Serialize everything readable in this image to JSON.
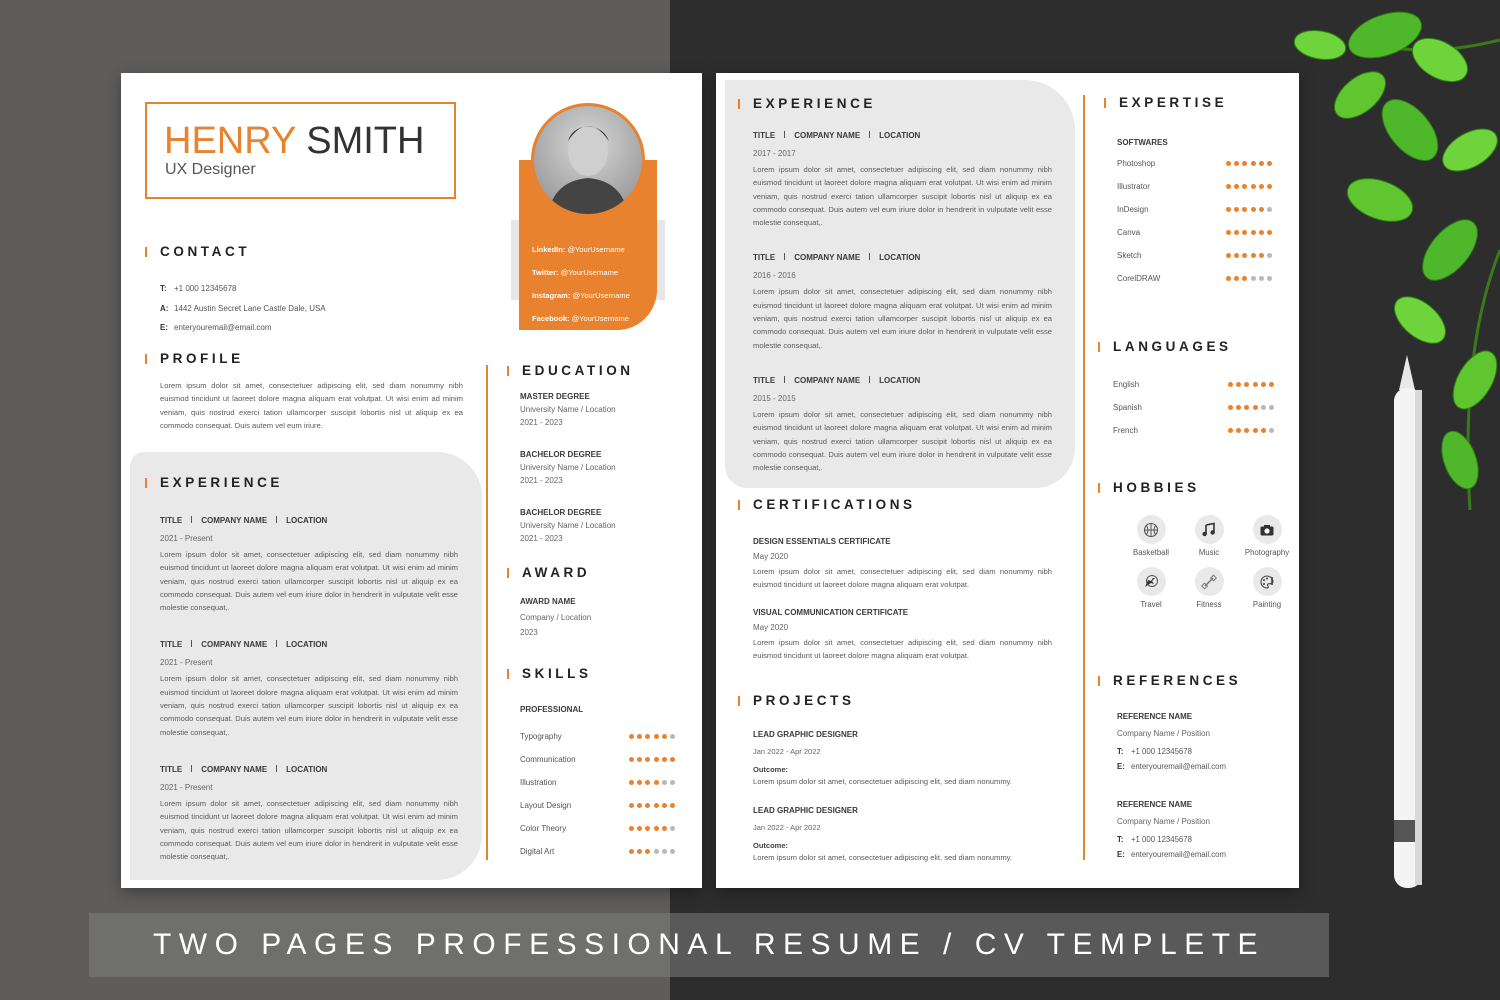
{
  "colors": {
    "accent": "#e8822e",
    "panel": "#e9e9e9",
    "text": "#222222"
  },
  "banner": {
    "text": "TWO PAGES PROFESSIONAL RESUME / CV TEMPLETE"
  },
  "page1": {
    "name": {
      "first": "HENRY",
      "last": "SMITH",
      "title": "UX Designer"
    },
    "social": [
      {
        "label": "LinkedIn:",
        "value": "@YourUsername"
      },
      {
        "label": "Twitter:",
        "value": "@YourUsername"
      },
      {
        "label": "Instagram:",
        "value": "@YourUsername"
      },
      {
        "label": "Facebook:",
        "value": "@YourUsername"
      }
    ],
    "contact": {
      "heading": "CONTACT",
      "items": [
        {
          "key": "T:",
          "value": "+1 000 12345678"
        },
        {
          "key": "A:",
          "value": "1442 Austin Secret Lane Castle Dale, USA"
        },
        {
          "key": "E:",
          "value": "enteryouremail@email.com"
        }
      ]
    },
    "profile": {
      "heading": "PROFILE",
      "text": "Lorem ipsum dolor sit amet, consectetuer adipiscing elit, sed diam nonummy nibh euismod tincidunt ut laoreet dolore magna aliquam erat volutpat. Ut wisi enim ad minim veniam, quis nostrud exerci tation ullamcorper suscipit lobortis nisl ut aliquip ex ea commodo consequat. Duis autem vel eum iriure."
    },
    "experience": {
      "heading": "EXPERIENCE",
      "entries": [
        {
          "title": "TITLE",
          "company": "COMPANY NAME",
          "location": "LOCATION",
          "date": "2021 - Present",
          "text": "Lorem ipsum dolor sit amet, consectetuer adipiscing elit, sed diam nonummy nibh euismod tincidunt ut laoreet dolore magna aliquam erat volutpat. Ut wisi enim ad minim veniam, quis nostrud exerci tation ullamcorper suscipit lobortis nisl ut aliquip ex ea commodo consequat. Duis autem vel eum iriure dolor in hendrerit in vulputate velit esse molestie consequat,."
        },
        {
          "title": "TITLE",
          "company": "COMPANY NAME",
          "location": "LOCATION",
          "date": "2021 - Present",
          "text": "Lorem ipsum dolor sit amet, consectetuer adipiscing elit, sed diam nonummy nibh euismod tincidunt ut laoreet dolore magna aliquam erat volutpat. Ut wisi enim ad minim veniam, quis nostrud exerci tation ullamcorper suscipit lobortis nisl ut aliquip ex ea commodo consequat. Duis autem vel eum iriure dolor in hendrerit in vulputate velit esse molestie consequat,."
        },
        {
          "title": "TITLE",
          "company": "COMPANY NAME",
          "location": "LOCATION",
          "date": "2021 - Present",
          "text": "Lorem ipsum dolor sit amet, consectetuer adipiscing elit, sed diam nonummy nibh euismod tincidunt ut laoreet dolore magna aliquam erat volutpat. Ut wisi enim ad minim veniam, quis nostrud exerci tation ullamcorper suscipit lobortis nisl ut aliquip ex ea commodo consequat. Duis autem vel eum iriure dolor in hendrerit in vulputate velit esse molestie consequat,."
        }
      ]
    },
    "education": {
      "heading": "EDUCATION",
      "entries": [
        {
          "degree": "MASTER DEGREE",
          "school": "University Name / Location",
          "years": "2021 - 2023"
        },
        {
          "degree": "BACHELOR DEGREE",
          "school": "University Name / Location",
          "years": "2021 - 2023"
        },
        {
          "degree": "BACHELOR DEGREE",
          "school": "University Name / Location",
          "years": "2021 - 2023"
        }
      ]
    },
    "award": {
      "heading": "AWARD",
      "entries": [
        {
          "name": "AWARD NAME",
          "company": "Company / Location",
          "year": "2023"
        }
      ]
    },
    "skills": {
      "heading": "SKILLS",
      "subheading": "PROFESSIONAL",
      "max": 6,
      "items": [
        {
          "name": "Typography",
          "rating": 5
        },
        {
          "name": "Communication",
          "rating": 6
        },
        {
          "name": "Illustration",
          "rating": 4
        },
        {
          "name": "Layout Design",
          "rating": 6
        },
        {
          "name": "Color Theory",
          "rating": 5
        },
        {
          "name": "Digital Art",
          "rating": 3
        }
      ]
    }
  },
  "page2": {
    "experience": {
      "heading": "EXPERIENCE",
      "entries": [
        {
          "title": "TITLE",
          "company": "COMPANY NAME",
          "location": "LOCATION",
          "date": "2017 - 2017",
          "text": "Lorem ipsum dolor sit amet, consectetuer adipiscing elit, sed diam nonummy nibh euismod tincidunt ut laoreet dolore magna aliquam erat volutpat. Ut wisi enim ad minim veniam, quis nostrud exerci tation ullamcorper suscipit lobortis nisl ut aliquip ex ea commodo consequat. Duis autem vel eum iriure dolor in hendrerit in vulputate velit esse molestie consequat,."
        },
        {
          "title": "TITLE",
          "company": "COMPANY NAME",
          "location": "LOCATION",
          "date": "2016 - 2016",
          "text": "Lorem ipsum dolor sit amet, consectetuer adipiscing elit, sed diam nonummy nibh euismod tincidunt ut laoreet dolore magna aliquam erat volutpat. Ut wisi enim ad minim veniam, quis nostrud exerci tation ullamcorper suscipit lobortis nisl ut aliquip ex ea commodo consequat. Duis autem vel eum iriure dolor in hendrerit in vulputate velit esse molestie consequat,."
        },
        {
          "title": "TITLE",
          "company": "COMPANY NAME",
          "location": "LOCATION",
          "date": "2015 - 2015",
          "text": "Lorem ipsum dolor sit amet, consectetuer adipiscing elit, sed diam nonummy nibh euismod tincidunt ut laoreet dolore magna aliquam erat volutpat. Ut wisi enim ad minim veniam, quis nostrud exerci tation ullamcorper suscipit lobortis nisl ut aliquip ex ea commodo consequat. Duis autem vel eum iriure dolor in hendrerit in vulputate velit esse molestie consequat,."
        }
      ]
    },
    "certifications": {
      "heading": "CERTIFICATIONS",
      "entries": [
        {
          "name": "DESIGN ESSENTIALS CERTIFICATE",
          "date": "May 2020",
          "text": "Lorem ipsum dolor sit amet, consectetuer adipiscing elit, sed diam nonummy nibh euismod tincidunt ut laoreet dolore magna aliquam erat volutpat."
        },
        {
          "name": "VISUAL COMMUNICATION CERTIFICATE",
          "date": "May 2020",
          "text": "Lorem ipsum dolor sit amet, consectetuer adipiscing elit, sed diam nonummy nibh euismod tincidunt ut laoreet dolore magna aliquam erat volutpat."
        }
      ]
    },
    "projects": {
      "heading": "PROJECTS",
      "entries": [
        {
          "title": "LEAD GRAPHIC DESIGNER",
          "date": "Jan 2022 - Apr 2022",
          "outcome_label": "Outcome:",
          "text": "Lorem ipsum dolor sit amet, consectetuer adipiscing elit, sed diam nonummy."
        },
        {
          "title": "LEAD GRAPHIC DESIGNER",
          "date": "Jan 2022 - Apr 2022",
          "outcome_label": "Outcome:",
          "text": "Lorem ipsum dolor sit amet, consectetuer adipiscing elit, sed diam nonummy."
        }
      ]
    },
    "expertise": {
      "heading": "EXPERTISE",
      "subheading": "SOFTWARES",
      "max": 6,
      "items": [
        {
          "name": "Photoshop",
          "rating": 6
        },
        {
          "name": "Illustrator",
          "rating": 6
        },
        {
          "name": "InDesign",
          "rating": 5
        },
        {
          "name": "Canva",
          "rating": 6
        },
        {
          "name": "Sketch",
          "rating": 5
        },
        {
          "name": "CorelDRAW",
          "rating": 3
        }
      ]
    },
    "languages": {
      "heading": "LANGUAGES",
      "max": 6,
      "items": [
        {
          "name": "English",
          "rating": 6
        },
        {
          "name": "Spanish",
          "rating": 4
        },
        {
          "name": "French",
          "rating": 5
        }
      ]
    },
    "hobbies": {
      "heading": "HOBBIES",
      "items": [
        {
          "label": "Basketball",
          "icon": "basketball-icon"
        },
        {
          "label": "Music",
          "icon": "music-icon"
        },
        {
          "label": "Photography",
          "icon": "camera-icon"
        },
        {
          "label": "Travel",
          "icon": "travel-icon"
        },
        {
          "label": "Fitness",
          "icon": "dumbbell-icon"
        },
        {
          "label": "Painting",
          "icon": "palette-icon"
        }
      ]
    },
    "references": {
      "heading": "REFERENCES",
      "entries": [
        {
          "name": "REFERENCE NAME",
          "company": "Company Name / Position",
          "phone_key": "T:",
          "phone": "+1 000 12345678",
          "email_key": "E:",
          "email": "enteryouremail@email.com"
        },
        {
          "name": "REFERENCE NAME",
          "company": "Company Name / Position",
          "phone_key": "T:",
          "phone": "+1 000 12345678",
          "email_key": "E:",
          "email": "enteryouremail@email.com"
        }
      ]
    }
  }
}
